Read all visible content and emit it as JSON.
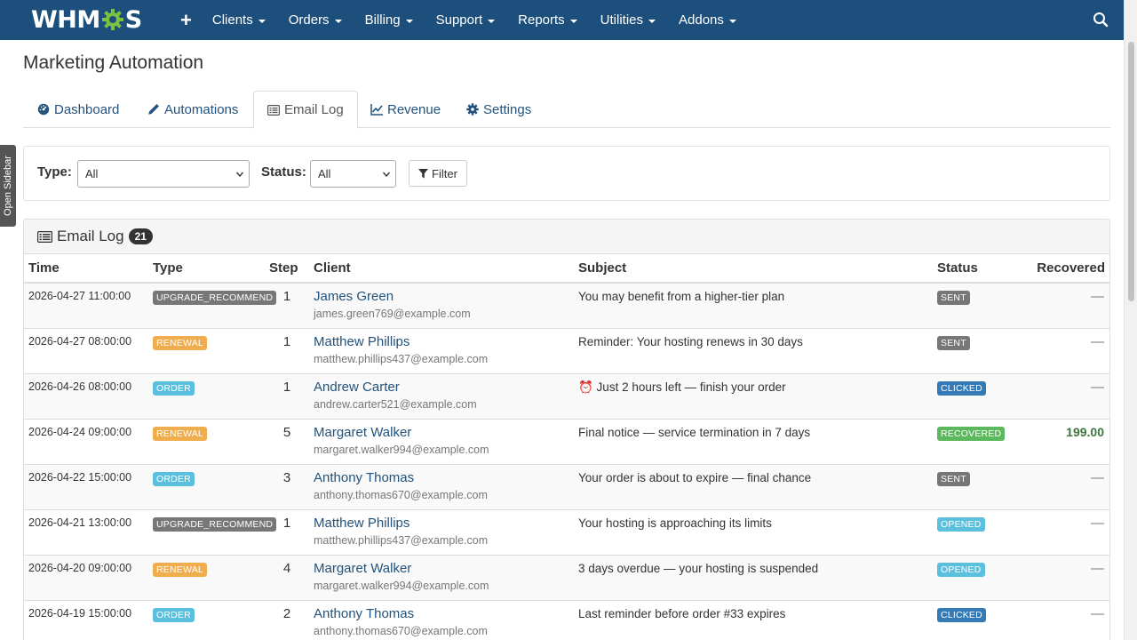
{
  "nav": {
    "brand": "WHMCS",
    "brand_left": "WHM",
    "brand_right": "S",
    "plus": "+",
    "items": [
      {
        "label": "Clients"
      },
      {
        "label": "Orders"
      },
      {
        "label": "Billing"
      },
      {
        "label": "Support"
      },
      {
        "label": "Reports"
      },
      {
        "label": "Utilities"
      },
      {
        "label": "Addons"
      }
    ],
    "search_icon": "search-icon"
  },
  "sidebar_toggle": "Open Sidebar",
  "page_title": "Marketing Automation",
  "tabs": [
    {
      "label": "Dashboard",
      "icon": "dashboard-icon",
      "active": false
    },
    {
      "label": "Automations",
      "icon": "pencil-icon",
      "active": false
    },
    {
      "label": "Email Log",
      "icon": "list-icon",
      "active": true
    },
    {
      "label": "Revenue",
      "icon": "line-chart-icon",
      "active": false
    },
    {
      "label": "Settings",
      "icon": "gear-icon",
      "active": false
    }
  ],
  "filter": {
    "type_label": "Type:",
    "type_value": "All",
    "status_label": "Status:",
    "status_value": "All",
    "button_label": "Filter"
  },
  "log": {
    "title": "Email Log",
    "count": "21",
    "columns": {
      "time": "Time",
      "type": "Type",
      "step": "Step",
      "client": "Client",
      "subject": "Subject",
      "status": "Status",
      "recovered": "Recovered"
    },
    "rows": [
      {
        "time": "2026-04-27 11:00:00",
        "type": "UPGRADE_RECOMMEND",
        "step": "1",
        "client": "James Green",
        "email": "james.green769@example.com",
        "subject": "You may benefit from a higher-tier plan",
        "status": "SENT",
        "recovered": "—"
      },
      {
        "time": "2026-04-27 08:00:00",
        "type": "RENEWAL",
        "step": "1",
        "client": "Matthew Phillips",
        "email": "matthew.phillips437@example.com",
        "subject": "Reminder: Your hosting renews in 30 days",
        "status": "SENT",
        "recovered": "—"
      },
      {
        "time": "2026-04-26 08:00:00",
        "type": "ORDER",
        "step": "1",
        "client": "Andrew Carter",
        "email": "andrew.carter521@example.com",
        "subject": "⏰ Just 2 hours left — finish your order",
        "status": "CLICKED",
        "recovered": "—"
      },
      {
        "time": "2026-04-24 09:00:00",
        "type": "RENEWAL",
        "step": "5",
        "client": "Margaret Walker",
        "email": "margaret.walker994@example.com",
        "subject": "Final notice — service termination in 7 days",
        "status": "RECOVERED",
        "recovered": "199.00"
      },
      {
        "time": "2026-04-22 15:00:00",
        "type": "ORDER",
        "step": "3",
        "client": "Anthony Thomas",
        "email": "anthony.thomas670@example.com",
        "subject": "Your order is about to expire — final chance",
        "status": "SENT",
        "recovered": "—"
      },
      {
        "time": "2026-04-21 13:00:00",
        "type": "UPGRADE_RECOMMEND",
        "step": "1",
        "client": "Matthew Phillips",
        "email": "matthew.phillips437@example.com",
        "subject": "Your hosting is approaching its limits",
        "status": "OPENED",
        "recovered": "—"
      },
      {
        "time": "2026-04-20 09:00:00",
        "type": "RENEWAL",
        "step": "4",
        "client": "Margaret Walker",
        "email": "margaret.walker994@example.com",
        "subject": "3 days overdue — your hosting is suspended",
        "status": "OPENED",
        "recovered": "—"
      },
      {
        "time": "2026-04-19 15:00:00",
        "type": "ORDER",
        "step": "2",
        "client": "Anthony Thomas",
        "email": "anthony.thomas670@example.com",
        "subject": "Last reminder before order #33 expires",
        "status": "CLICKED",
        "recovered": "—"
      }
    ]
  },
  "colors": {
    "nav_bg": "#1d4f7c",
    "UPGRADE_RECOMMEND": "#777777",
    "RENEWAL": "#f0ad4e",
    "ORDER": "#5bc0de",
    "SENT": "#777777",
    "CLICKED": "#337ab7",
    "RECOVERED": "#5cb85c",
    "OPENED": "#5bc0de"
  }
}
